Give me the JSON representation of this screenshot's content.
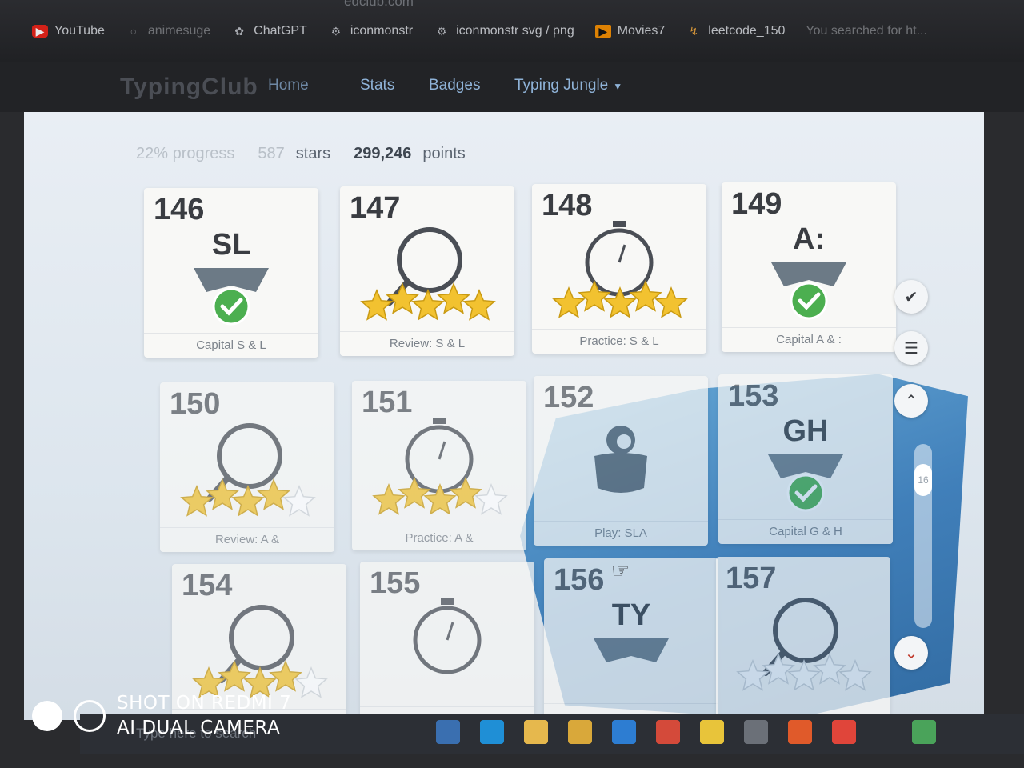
{
  "browser": {
    "url_fragment": "edclub.com",
    "bookmarks": [
      {
        "label": "YouTube",
        "icon": "youtube-icon"
      },
      {
        "label": "animesuge",
        "icon": "site-icon"
      },
      {
        "label": "ChatGPT",
        "icon": "chatgpt-icon"
      },
      {
        "label": "iconmonstr",
        "icon": "iconmonstr-icon"
      },
      {
        "label": "iconmonstr svg / png",
        "icon": "iconmonstr-icon"
      },
      {
        "label": "Movies7",
        "icon": "movies-icon"
      },
      {
        "label": "leetcode_150",
        "icon": "leetcode-icon"
      },
      {
        "label": "You searched for ht...",
        "icon": "search-result-icon"
      }
    ]
  },
  "site": {
    "logo": "TypingClub",
    "nav": [
      {
        "label": "Home"
      },
      {
        "label": "Stats"
      },
      {
        "label": "Badges"
      },
      {
        "label": "Typing Jungle"
      }
    ]
  },
  "progress": {
    "progress_text": "22% progress",
    "stars_count": "587",
    "stars_label": "stars",
    "points_value": "299,246",
    "points_label": "points"
  },
  "lessons": [
    {
      "number": "146",
      "big": "SL",
      "type": "capital",
      "label": "Capital S & L",
      "done": true
    },
    {
      "number": "147",
      "big": "",
      "type": "review",
      "label": "Review: S & L",
      "stars": 5
    },
    {
      "number": "148",
      "big": "",
      "type": "practice",
      "label": "Practice: S & L",
      "stars": 5
    },
    {
      "number": "149",
      "big": "A:",
      "type": "capital",
      "label": "Capital A & :",
      "done": true
    },
    {
      "number": "150",
      "big": "",
      "type": "review",
      "label": "Review: A &",
      "stars": 4
    },
    {
      "number": "151",
      "big": "",
      "type": "practice",
      "label": "Practice: A &",
      "stars": 4
    },
    {
      "number": "152",
      "big": "",
      "type": "game",
      "label": "Play: SLA"
    },
    {
      "number": "153",
      "big": "GH",
      "type": "capital",
      "label": "Capital G & H",
      "done": true
    },
    {
      "number": "154",
      "big": "",
      "type": "review",
      "label": "",
      "stars": 4
    },
    {
      "number": "155",
      "big": "",
      "type": "practice",
      "label": "",
      "stars": 0
    },
    {
      "number": "156",
      "big": "TY",
      "type": "capital",
      "label": "",
      "done": false
    },
    {
      "number": "157",
      "big": "",
      "type": "review",
      "label": "",
      "stars": 0
    }
  ],
  "side_controls": {
    "scroll_value": "16"
  },
  "taskbar": {
    "search_placeholder": "Type here to search"
  },
  "watermark": {
    "line1": "SHOT ON REDMI 7",
    "line2": "AI DUAL CAMERA"
  }
}
